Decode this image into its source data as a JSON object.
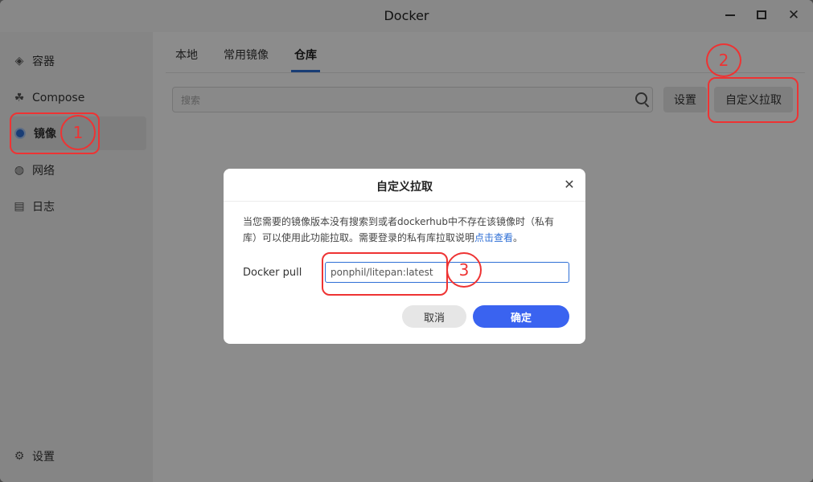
{
  "window": {
    "title": "Docker"
  },
  "sidebar": {
    "items": [
      {
        "label": "容器",
        "icon": "layers-icon"
      },
      {
        "label": "Compose",
        "icon": "compose-icon"
      },
      {
        "label": "镜像",
        "icon": "image-icon",
        "active": true
      },
      {
        "label": "网络",
        "icon": "globe-icon"
      },
      {
        "label": "日志",
        "icon": "log-icon"
      }
    ],
    "settings_label": "设置"
  },
  "tabs": [
    {
      "label": "本地"
    },
    {
      "label": "常用镜像"
    },
    {
      "label": "仓库",
      "active": true
    }
  ],
  "search": {
    "placeholder": "搜索"
  },
  "toolbar": {
    "settings_label": "设置",
    "custom_pull_label": "自定义拉取"
  },
  "modal": {
    "title": "自定义拉取",
    "desc_text": "当您需要的镜像版本没有搜索到或者dockerhub中不存在该镜像时（私有库）可以使用此功能拉取。需要登录的私有库拉取说明",
    "desc_link": "点击查看",
    "desc_tail": "。",
    "pull_label": "Docker pull",
    "pull_value": "ponphil/litepan:latest",
    "cancel_label": "取消",
    "ok_label": "确定"
  },
  "annotations": [
    "1",
    "2",
    "3"
  ],
  "colors": {
    "accent": "#2f6fd6",
    "confirm": "#3a63f0",
    "annotation": "#ee3333"
  }
}
